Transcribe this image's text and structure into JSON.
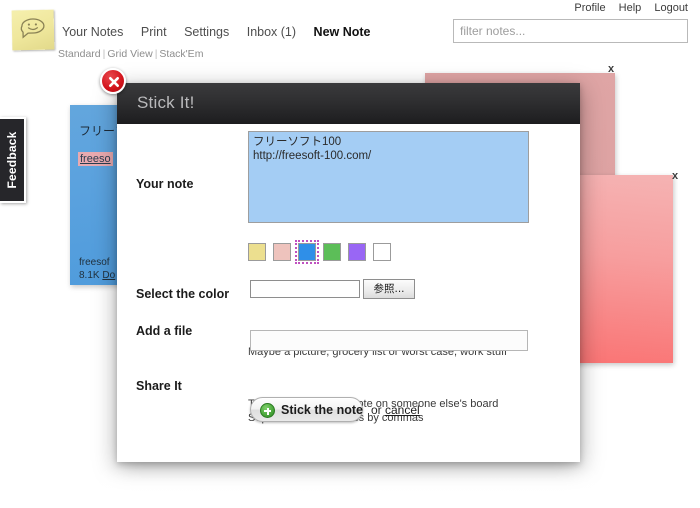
{
  "header": {
    "logo_icon": "sticky-note-smiley-icon",
    "account_links": [
      {
        "label": "Profile"
      },
      {
        "label": "Help"
      },
      {
        "label": "Logout"
      }
    ],
    "filter": {
      "placeholder": "filter notes...",
      "value": ""
    },
    "main_nav": [
      {
        "label": "Your Notes",
        "active": false
      },
      {
        "label": "Print",
        "active": false
      },
      {
        "label": "Settings",
        "active": false
      },
      {
        "label": "Inbox (1)",
        "active": false
      },
      {
        "label": "New Note",
        "active": true
      }
    ],
    "sub_nav": {
      "item1": "Standard",
      "sep1": "|",
      "item2": "Grid View",
      "sep2": "|",
      "item3": "Stack'Em"
    }
  },
  "feedback_tab": {
    "label": "Feedback"
  },
  "board": {
    "notes": [
      {
        "id": "note-blue",
        "color": "#5ba2de",
        "title": "フリーソ",
        "link": "freeso",
        "footer_line1": "freesof",
        "footer_line2_size": "8.1K",
        "footer_line2_link": "Do",
        "close_label": ""
      },
      {
        "id": "note-pink-pale",
        "color": "#dda2a2",
        "close_label": "x"
      },
      {
        "id": "note-pink-bright",
        "color": "#f79e9e",
        "close_label": "x"
      }
    ]
  },
  "modal": {
    "title": "Stick It!",
    "close_icon": "close-circle-icon",
    "fields": {
      "note": {
        "label": "Your note",
        "value": "フリーソフト100\nhttp://freesoft-100.com/"
      },
      "color": {
        "label": "Select the color",
        "options": [
          {
            "name": "yellow",
            "hex": "#ecdf8f",
            "selected": false
          },
          {
            "name": "pink",
            "hex": "#eec3bd",
            "selected": false
          },
          {
            "name": "blue",
            "hex": "#2f8fe8",
            "selected": true
          },
          {
            "name": "green",
            "hex": "#5cbe58",
            "selected": false
          },
          {
            "name": "purple",
            "hex": "#9966f5",
            "selected": false
          },
          {
            "name": "white",
            "hex": "#ffffff",
            "selected": false
          }
        ]
      },
      "file": {
        "label": "Add a file",
        "value": "",
        "browse_button": "参照...",
        "hint": "Maybe a picture, grocery list or worst case, work stuff"
      },
      "share": {
        "label": "Share It",
        "value": "",
        "hint_line1": "This lets you put this note on someone else's board",
        "hint_line2": "Separate email address by commas"
      }
    },
    "actions": {
      "submit_label": "Stick the note",
      "submit_icon": "plus-circle-icon",
      "or_text": "or",
      "cancel_label": "cancel"
    }
  }
}
